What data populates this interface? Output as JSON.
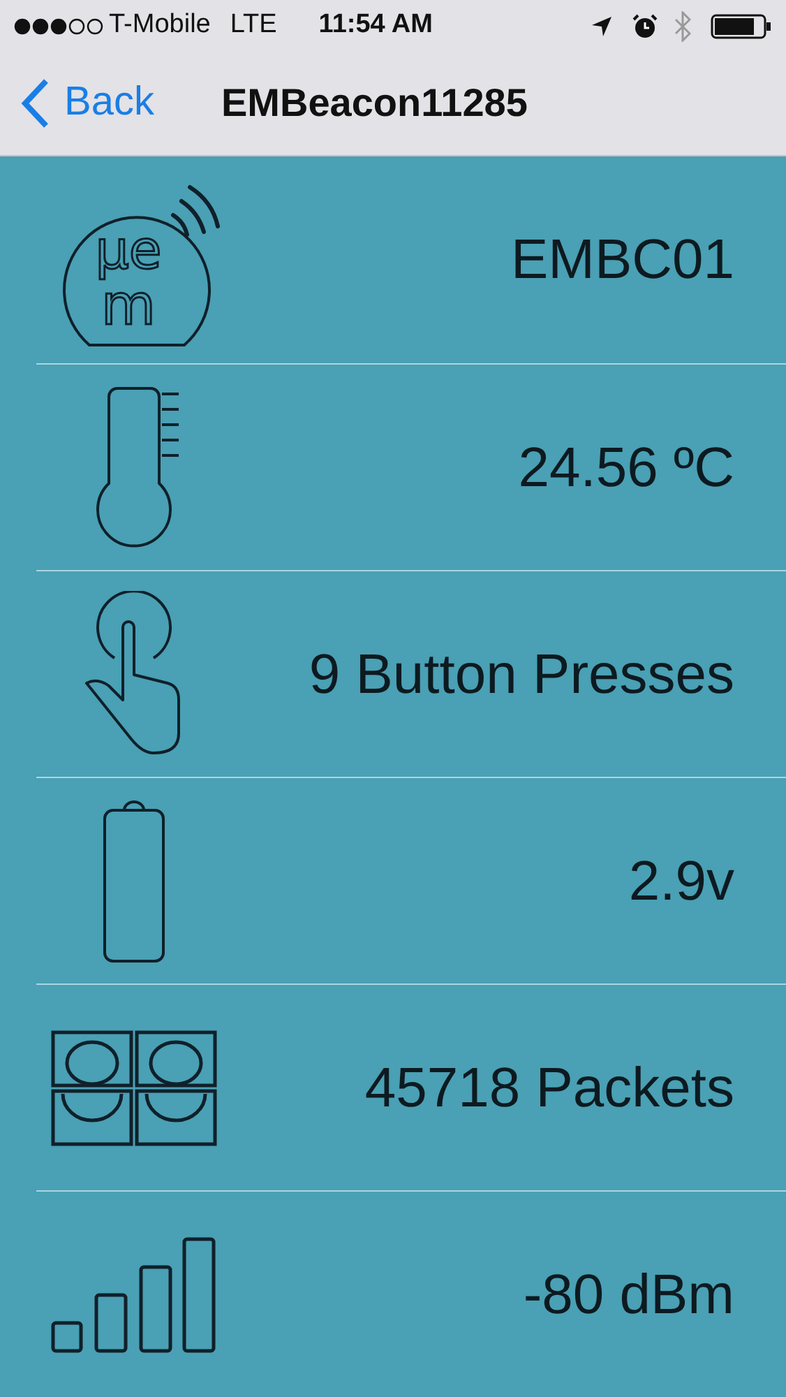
{
  "status_bar": {
    "carrier": "T-Mobile",
    "network": "LTE",
    "time": "11:54 AM"
  },
  "nav": {
    "back": "Back",
    "title": "EMBeacon11285"
  },
  "rows": [
    {
      "kind": "logo",
      "logo_text": [
        "μe",
        "m"
      ],
      "value": "EMBC01"
    },
    {
      "kind": "thermometer",
      "value": "24.56 ºC"
    },
    {
      "kind": "touch",
      "value": "9 Button Presses"
    },
    {
      "kind": "battery",
      "value": "2.9v"
    },
    {
      "kind": "packets",
      "value": "45718 Packets"
    },
    {
      "kind": "signal",
      "value": "-80 dBm"
    }
  ]
}
